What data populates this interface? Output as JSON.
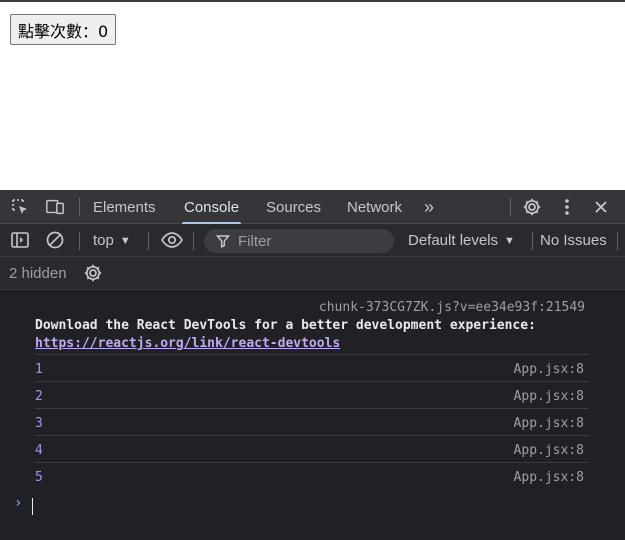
{
  "page": {
    "button_label": "點擊次數：0"
  },
  "devtools": {
    "tabs": [
      "Elements",
      "Console",
      "Sources",
      "Network"
    ],
    "more_tabs_glyph": "»",
    "toolbar": {
      "context": "top",
      "filter_placeholder": "Filter",
      "levels": "Default levels",
      "issues": "No Issues"
    },
    "hidden_count": "2 hidden",
    "console": {
      "first_source": "chunk-373CG7ZK.js?v=ee34e93f:21549",
      "devtools_msg": "Download the React DevTools for a better development experience:",
      "devtools_link": "https://reactjs.org/link/react-devtools",
      "logs": [
        {
          "value": "1",
          "source": "App.jsx:8"
        },
        {
          "value": "2",
          "source": "App.jsx:8"
        },
        {
          "value": "3",
          "source": "App.jsx:8"
        },
        {
          "value": "4",
          "source": "App.jsx:8"
        },
        {
          "value": "5",
          "source": "App.jsx:8"
        }
      ],
      "prompt_glyph": "›"
    },
    "colors": {
      "accent": "#a8c7fa",
      "log_number": "#a094f0",
      "link": "#c3a8f5"
    }
  }
}
